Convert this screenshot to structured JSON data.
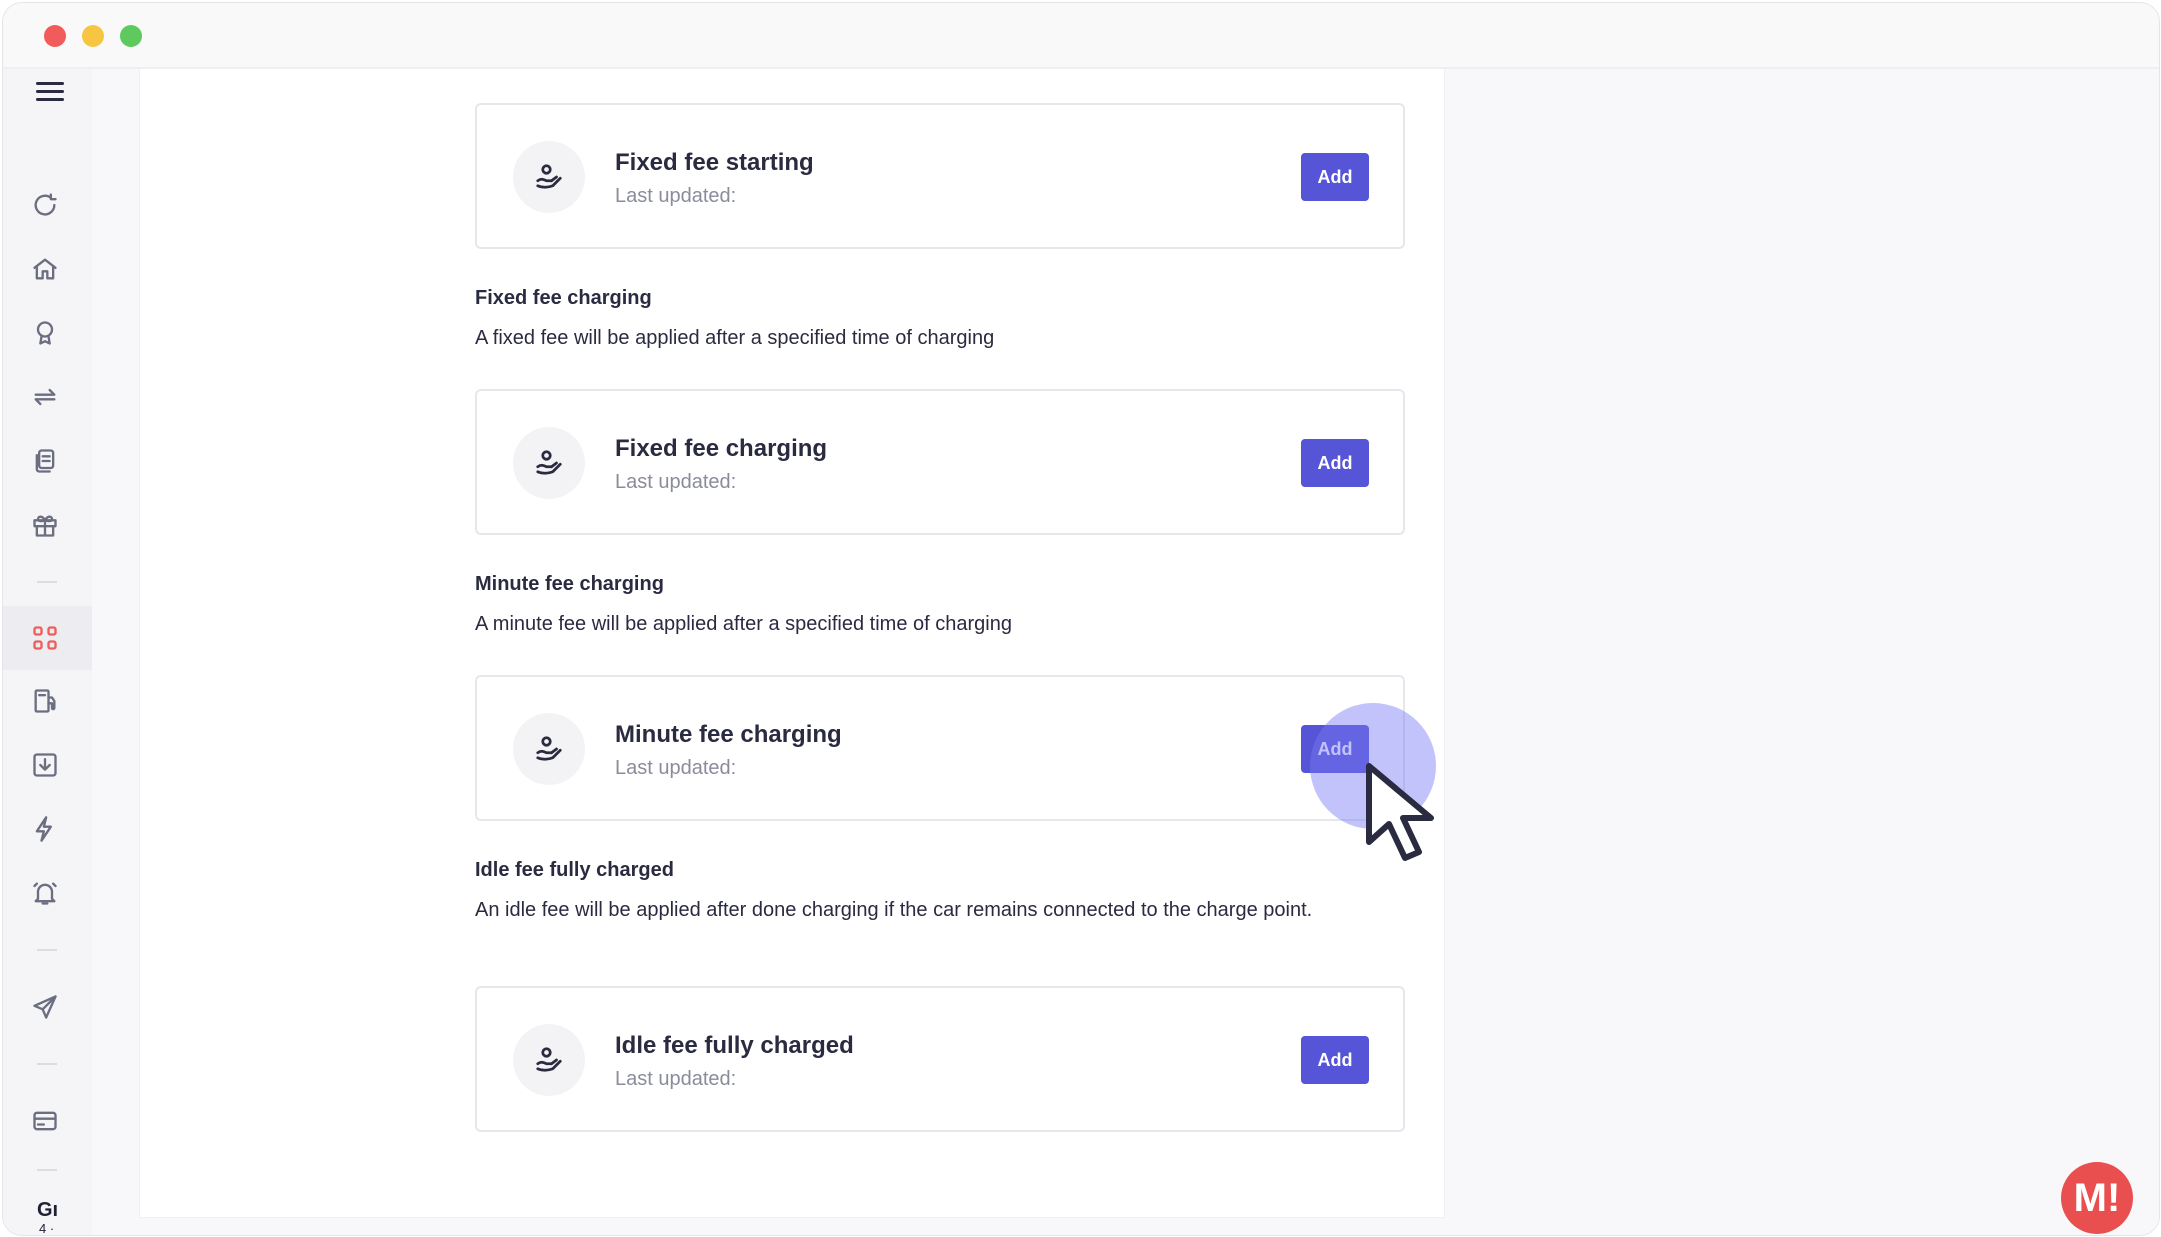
{
  "window": {
    "controls": [
      "close",
      "minimize",
      "maximize"
    ]
  },
  "sidebar": {
    "icons": [
      {
        "name": "refresh-icon"
      },
      {
        "name": "home-icon"
      },
      {
        "name": "lightbulb-icon"
      },
      {
        "name": "transfer-icon"
      },
      {
        "name": "documents-icon"
      },
      {
        "name": "gift-icon"
      },
      {
        "name": "grid-icon",
        "active": true
      },
      {
        "name": "fuel-station-icon"
      },
      {
        "name": "download-icon"
      },
      {
        "name": "lightning-icon"
      },
      {
        "name": "alarm-bell-icon"
      },
      {
        "name": "send-icon"
      },
      {
        "name": "card-icon"
      }
    ],
    "user_initials": "Gı",
    "user_sub": "4 ·"
  },
  "cards": [
    {
      "title": "Fixed fee starting",
      "updated": "Last updated:",
      "button": "Add"
    },
    {
      "title": "Fixed fee charging",
      "updated": "Last updated:",
      "button": "Add"
    },
    {
      "title": "Minute fee charging",
      "updated": "Last updated:",
      "button": "Add"
    },
    {
      "title": "Idle fee fully charged",
      "updated": "Last updated:",
      "button": "Add"
    }
  ],
  "sections": [
    {
      "title": "Fixed fee charging",
      "desc": "A fixed fee will be applied after a specified time of charging"
    },
    {
      "title": "Minute fee charging",
      "desc": "A minute fee will be applied after a specified time of charging"
    },
    {
      "title": "Idle fee fully charged",
      "desc": "An idle fee will be applied after done charging if the car remains connected to the charge point."
    }
  ],
  "help_badge": "M!",
  "colors": {
    "accent": "#5654d7",
    "active_nav": "#ef5c5c",
    "badge": "#e94f4f"
  }
}
